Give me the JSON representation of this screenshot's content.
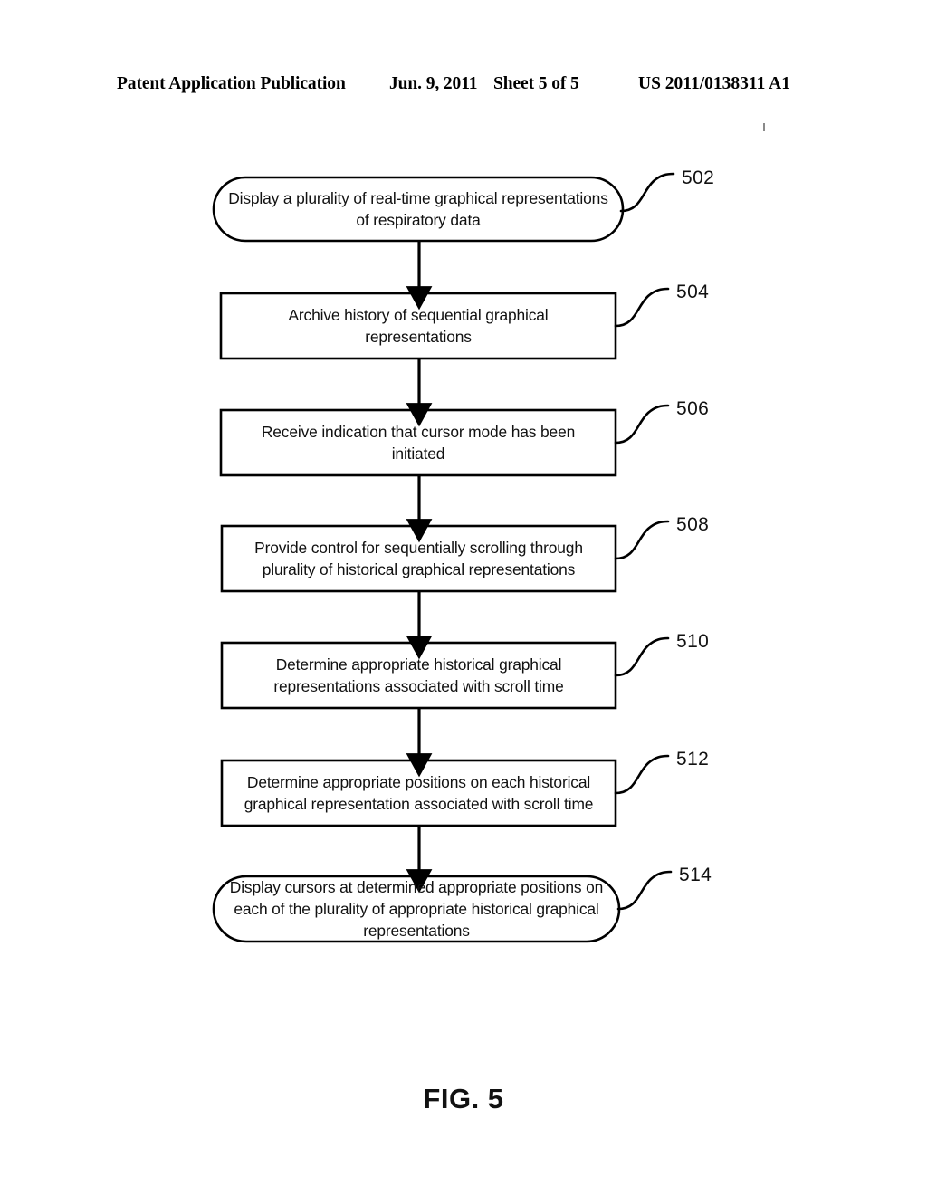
{
  "header": {
    "publication": "Patent Application Publication",
    "date": "Jun. 9, 2011",
    "sheet": "Sheet 5 of 5",
    "patent_number": "US 2011/0138311 A1"
  },
  "figure": {
    "caption": "FIG. 5",
    "type": "flowchart",
    "line_color": "#000000",
    "fill_color": "#ffffff"
  },
  "flowchart": {
    "nodes": [
      {
        "ref": "502",
        "shape": "stadium",
        "lines": [
          "Display a plurality of real-time graphical",
          "representations of respiratory data"
        ],
        "text": "Display a plurality of real-time graphical representations of respiratory data"
      },
      {
        "ref": "504",
        "shape": "rectangle",
        "lines": [
          "Archive history of sequential graphical",
          "representations"
        ],
        "text": "Archive history of sequential graphical representations"
      },
      {
        "ref": "506",
        "shape": "rectangle",
        "lines": [
          "Receive indication that cursor mode has been",
          "initiated"
        ],
        "text": "Receive indication that cursor mode has been initiated"
      },
      {
        "ref": "508",
        "shape": "rectangle",
        "lines": [
          "Provide control for sequentially scrolling through",
          "plurality of historical graphical representations"
        ],
        "text": "Provide control for sequentially scrolling through plurality of historical graphical representations"
      },
      {
        "ref": "510",
        "shape": "rectangle",
        "lines": [
          "Determine appropriate historical graphical",
          "representations associated with scroll time"
        ],
        "text": "Determine appropriate historical graphical representations associated with scroll time"
      },
      {
        "ref": "512",
        "shape": "rectangle",
        "lines": [
          "Determine appropriate positions on each historical",
          "graphical representation associated with scroll time"
        ],
        "text": "Determine appropriate positions on each historical graphical representation associated with scroll time"
      },
      {
        "ref": "514",
        "shape": "stadium",
        "lines": [
          "Display cursors at determined appropriate positions",
          "on each of the plurality of appropriate historical",
          "graphical representations"
        ],
        "text": "Display cursors at determined appropriate positions on each of the plurality of appropriate historical graphical representations"
      }
    ],
    "connectors": [
      {
        "from": "502",
        "to": "504",
        "style": "arrow-down"
      },
      {
        "from": "504",
        "to": "506",
        "style": "arrow-down"
      },
      {
        "from": "506",
        "to": "508",
        "style": "arrow-down"
      },
      {
        "from": "508",
        "to": "510",
        "style": "arrow-down"
      },
      {
        "from": "510",
        "to": "512",
        "style": "arrow-down"
      },
      {
        "from": "512",
        "to": "514",
        "style": "arrow-down"
      }
    ]
  }
}
